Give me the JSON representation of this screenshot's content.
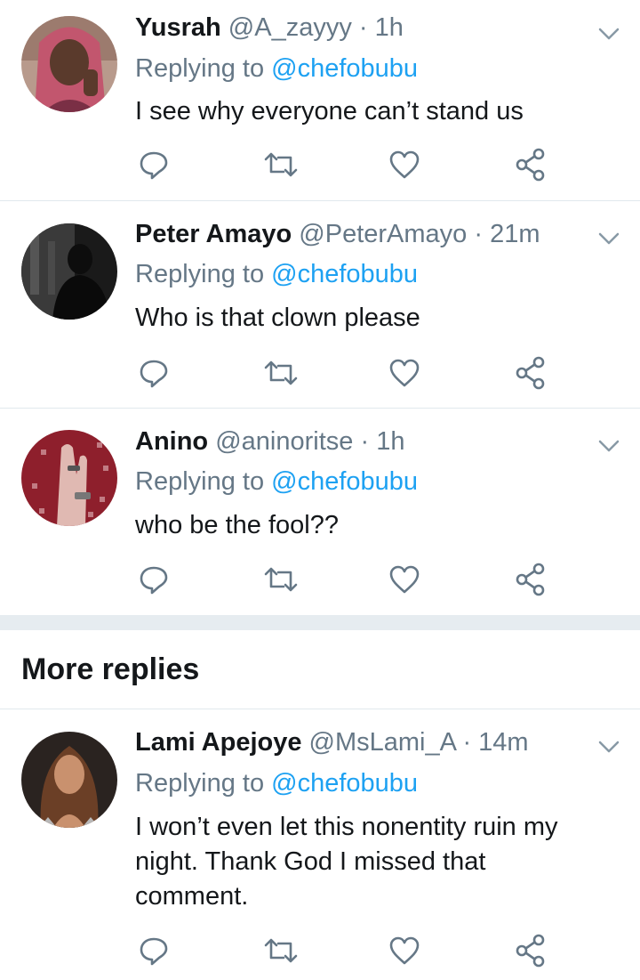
{
  "colors": {
    "accent": "#1da1f2",
    "secondary_text": "#657786",
    "primary_text": "#14171a",
    "divider": "#e1e8ed",
    "section_gap": "#e6ecf0"
  },
  "tweets": [
    {
      "name": "Yusrah",
      "handle": "@A_zayyy",
      "separator": "·",
      "time": "1h",
      "replying_prefix": "Replying to",
      "replying_to": "@chefobubu",
      "text": "I see why everyone can’t stand us"
    },
    {
      "name": "Peter Amayo",
      "handle": "@PeterAmayo",
      "separator": "·",
      "time": "21m",
      "replying_prefix": "Replying to",
      "replying_to": "@chefobubu",
      "text": "Who is that clown please"
    },
    {
      "name": "Anino",
      "handle": "@aninoritse",
      "separator": "·",
      "time": "1h",
      "replying_prefix": "Replying to",
      "replying_to": "@chefobubu",
      "text": "who be the fool??"
    }
  ],
  "more_replies": {
    "title": "More replies",
    "tweets": [
      {
        "name": "Lami Apejoye",
        "handle": "@MsLami_A",
        "separator": "·",
        "time": "14m",
        "replying_prefix": "Replying to",
        "replying_to": "@chefobubu",
        "text": "I won’t even let this nonentity ruin my night. Thank God I missed that comment."
      }
    ]
  },
  "icons": {
    "reply": "reply-icon",
    "retweet": "retweet-icon",
    "like": "heart-icon",
    "share": "share-icon",
    "menu": "chevron-down-icon"
  }
}
